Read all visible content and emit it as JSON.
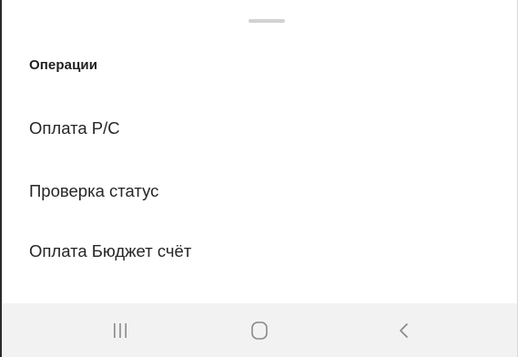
{
  "sheet": {
    "section_title": "Операции",
    "items": [
      {
        "label": "Оплата Р/С"
      },
      {
        "label": "Проверка статус"
      },
      {
        "label": "Оплата Бюджет счёт"
      }
    ]
  },
  "navbar": {
    "buttons": [
      {
        "icon": "recents-icon"
      },
      {
        "icon": "home-icon"
      },
      {
        "icon": "back-icon"
      }
    ],
    "background": "#f2f2f2",
    "icon_color": "#8a8a8a"
  }
}
